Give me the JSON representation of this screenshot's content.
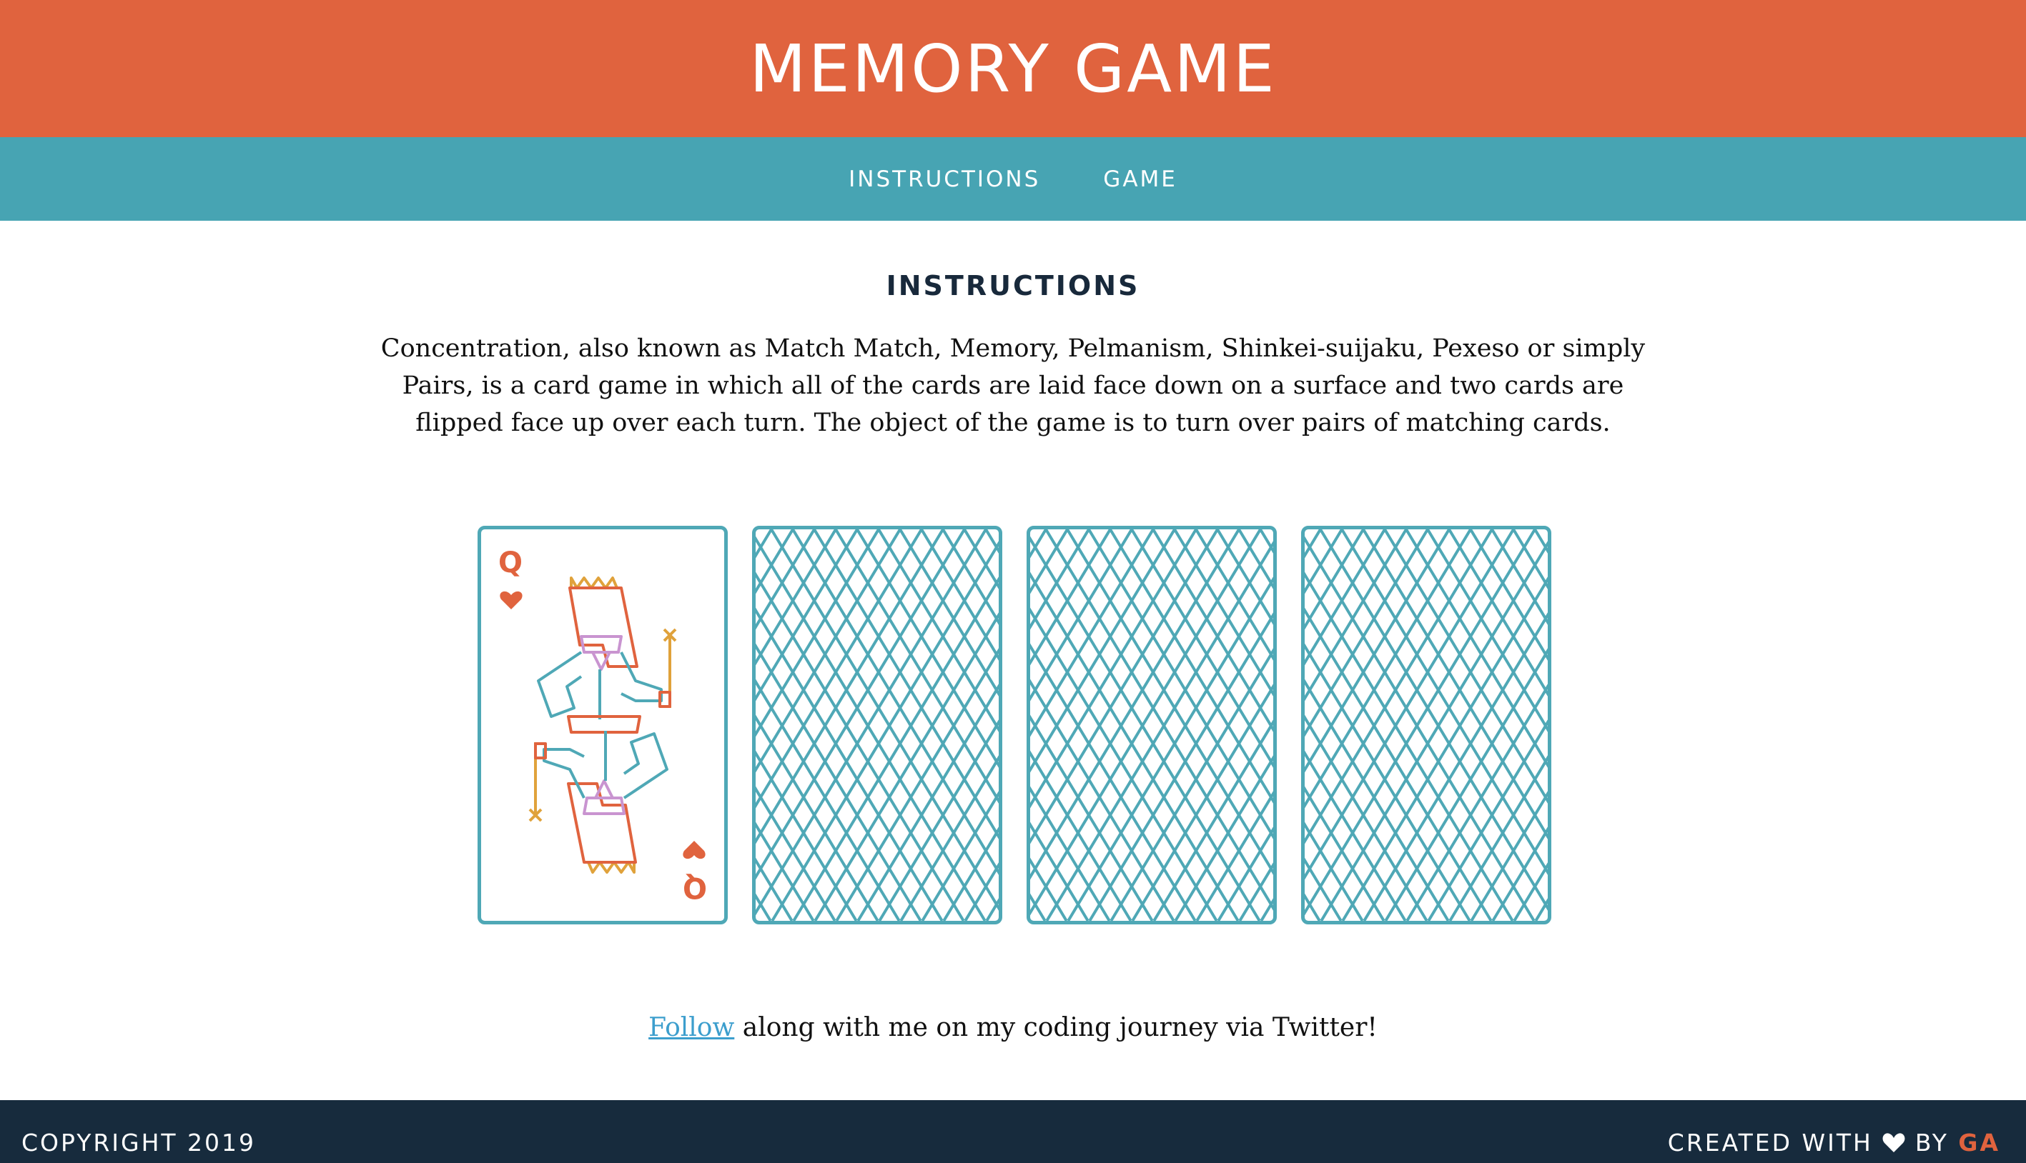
{
  "header": {
    "title": "MEMORY GAME"
  },
  "nav": {
    "items": [
      {
        "label": "INSTRUCTIONS"
      },
      {
        "label": "GAME"
      }
    ]
  },
  "instructions": {
    "heading": "INSTRUCTIONS",
    "text": "Concentration, also known as Match Match, Memory, Pelmanism, Shinkei-suijaku, Pexeso or simply Pairs, is a card game in which all of the cards are laid face down on a surface and two cards are flipped face up over each turn. The object of the game is to turn over pairs of matching cards."
  },
  "cards": [
    {
      "face": "up",
      "rank": "Q",
      "suit": "hearts",
      "icon": "queen-of-hearts-card"
    },
    {
      "face": "down",
      "icon": "card-back-pattern"
    },
    {
      "face": "down",
      "icon": "card-back-pattern"
    },
    {
      "face": "down",
      "icon": "card-back-pattern"
    }
  ],
  "follow": {
    "link_text": "Follow",
    "text": " along with me on my coding journey via Twitter!"
  },
  "footer": {
    "copyright": "COPYRIGHT 2019",
    "created_with": "CREATED WITH",
    "by": "BY",
    "author": "GA"
  },
  "colors": {
    "header": "#e0633e",
    "nav": "#47a4b3",
    "card_border": "#4fa8b6",
    "footer": "#172b3d",
    "link": "#3c9ecd"
  }
}
